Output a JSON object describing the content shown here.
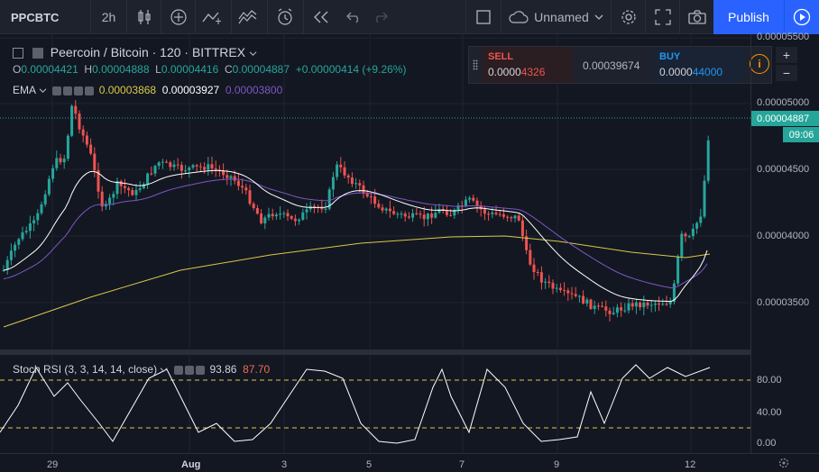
{
  "toolbar": {
    "symbol": "PPCBTC",
    "interval": "2h",
    "layout_name": "Unnamed",
    "publish_label": "Publish"
  },
  "legend": {
    "title": "Peercoin / Bitcoin · 120 · BITTREX",
    "o_label": "O",
    "o_value": "0.00004421",
    "h_label": "H",
    "h_value": "0.00004888",
    "l_label": "L",
    "l_value": "0.00004416",
    "c_label": "C",
    "c_value": "0.00004887",
    "change": "+0.00000414 (+9.26%)",
    "ema_label": "EMA",
    "ema_values": [
      "0.00003868",
      "0.00003927",
      "0.00003800"
    ],
    "rsi_label": "Stoch RSI (3, 3, 14, 14, close)",
    "rsi_values": [
      "93.86",
      "87.70"
    ]
  },
  "trade": {
    "sell_label": "SELL",
    "sell_price_prefix": "0.0000",
    "sell_price_suffix": "4326",
    "spread": "0.00039674",
    "buy_label": "BUY",
    "buy_price_prefix": "0.0000",
    "buy_price_suffix": "44000",
    "plus": "+",
    "minus": "−",
    "info": "i"
  },
  "price_axis": {
    "labels": [
      "0.00005500",
      "0.00005000",
      "0.00004500",
      "0.00004000",
      "0.00003500"
    ],
    "current_price": "0.00004887",
    "countdown": "09:06"
  },
  "rsi_axis": {
    "labels": [
      "80.00",
      "40.00",
      "0.00"
    ]
  },
  "time_axis": {
    "labels": [
      "29",
      "Aug",
      "3",
      "5",
      "7",
      "9",
      "12"
    ]
  },
  "colors": {
    "up": "#26a69a",
    "down": "#ef5350",
    "ema1": "#ffffff",
    "ema2": "#7e57c2",
    "ema3": "#d9c94a",
    "rsi_line": "#ffffff",
    "rsi_band": "#d9c94a"
  },
  "icons": [
    "bar-style-icon",
    "indicators-icon",
    "compare-icon",
    "templates-icon",
    "alert-icon",
    "replay-icon",
    "undo-icon",
    "redo-icon",
    "fullscreen-box-icon",
    "cloud-icon",
    "settings-icon",
    "expand-icon",
    "camera-icon",
    "play-icon"
  ]
}
